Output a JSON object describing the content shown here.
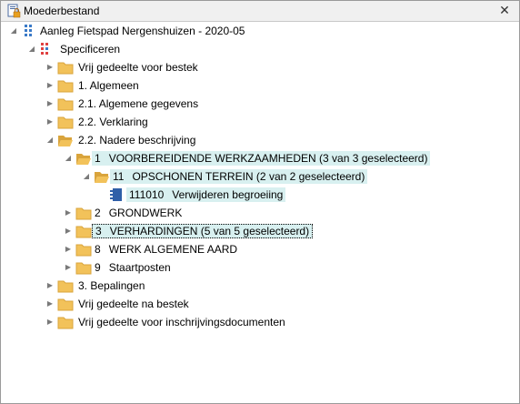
{
  "window": {
    "title": "Moederbestand",
    "close_glyph": "✕"
  },
  "tree": {
    "project": "Aanleg Fietspad Nergenshuizen - 2020-05",
    "specificeren": "Specificeren",
    "items": [
      {
        "label": "Vrij gedeelte voor bestek"
      },
      {
        "label": "1. Algemeen"
      },
      {
        "label": "2.1. Algemene gegevens"
      },
      {
        "label": "2.2. Verklaring"
      },
      {
        "label": "2.2. Nadere beschrijving"
      },
      {
        "num": "1",
        "label": "VOORBEREIDENDE WERKZAAMHEDEN (3 van 3 geselecteerd)"
      },
      {
        "num": "11",
        "label": "OPSCHONEN TERREIN (2 van 2 geselecteerd)"
      },
      {
        "num": "111010",
        "label": "Verwijderen begroeiing"
      },
      {
        "num": "2",
        "label": "GRONDWERK"
      },
      {
        "num": "3",
        "label": "VERHARDINGEN (5 van 5 geselecteerd)"
      },
      {
        "num": "8",
        "label": "WERK ALGEMENE AARD"
      },
      {
        "num": "9",
        "label": "Staartposten"
      },
      {
        "label": "3. Bepalingen"
      },
      {
        "label": "Vrij gedeelte na bestek"
      },
      {
        "label": "Vrij gedeelte voor inschrijvingsdocumenten"
      }
    ]
  },
  "colors": {
    "selected_bg": "#d8f0f0",
    "folder": "#f2c25a",
    "folder_dark": "#d9a43c"
  },
  "icons": [
    "document-lock-icon",
    "project-grid-icon",
    "specificeren-grid-icon",
    "folder-icon",
    "open-folder-icon",
    "document-icon"
  ]
}
